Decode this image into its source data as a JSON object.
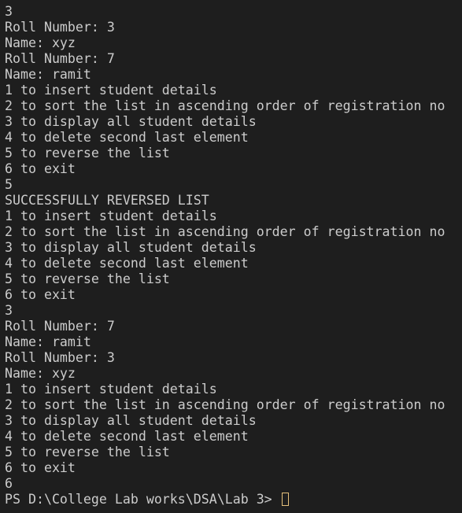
{
  "terminal": {
    "lines": [
      "6 to exit",
      "3",
      "Roll Number: 3",
      "Name: xyz",
      "Roll Number: 7",
      "Name: ramit",
      "1 to insert student details",
      "2 to sort the list in ascending order of registration no",
      "3 to display all student details",
      "4 to delete second last element",
      "5 to reverse the list",
      "6 to exit",
      "5",
      "SUCCESSFULLY REVERSED LIST",
      "1 to insert student details",
      "2 to sort the list in ascending order of registration no",
      "3 to display all student details",
      "4 to delete second last element",
      "5 to reverse the list",
      "6 to exit",
      "3",
      "Roll Number: 7",
      "Name: ramit",
      "Roll Number: 3",
      "Name: xyz",
      "1 to insert student details",
      "2 to sort the list in ascending order of registration no",
      "3 to display all student details",
      "4 to delete second last element",
      "5 to reverse the list",
      "6 to exit",
      "6"
    ],
    "prompt": "PS D:\\College Lab works\\DSA\\Lab 3> ",
    "cursor_color": "#e5c07b",
    "text_color": "#cccccc",
    "background_color": "#1e1e1e"
  }
}
